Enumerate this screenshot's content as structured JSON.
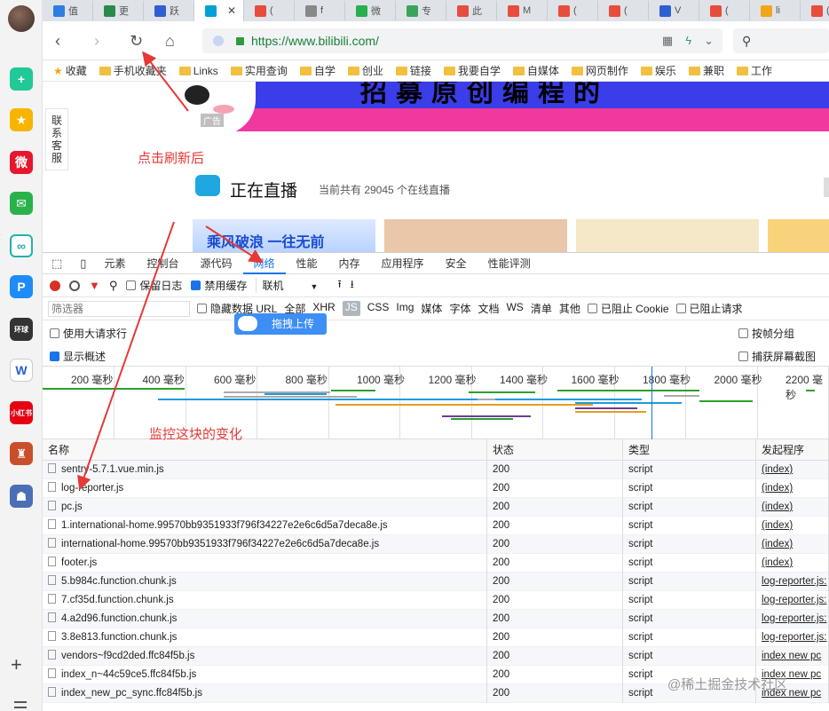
{
  "browser": {
    "tabs": [
      {
        "label": "值",
        "color": "#2f7de1"
      },
      {
        "label": "更",
        "color": "#2a8a4a"
      },
      {
        "label": "跃",
        "color": "#2f5fd1"
      },
      {
        "label": "",
        "color": "#00a1d6",
        "active": true
      },
      {
        "label": "(",
        "color": "#e84c3d"
      },
      {
        "label": "f",
        "color": "#888888"
      },
      {
        "label": "微",
        "color": "#26b04f"
      },
      {
        "label": "专",
        "color": "#3aa55a"
      },
      {
        "label": "此",
        "color": "#e84c3d"
      },
      {
        "label": "M",
        "color": "#e84c3d"
      },
      {
        "label": "(",
        "color": "#e84c3d"
      },
      {
        "label": "(",
        "color": "#e84c3d"
      },
      {
        "label": "V",
        "color": "#2f5fd1"
      },
      {
        "label": "(",
        "color": "#e84c3d"
      },
      {
        "label": "li",
        "color": "#f2a51a"
      },
      {
        "label": "(",
        "color": "#e84c3d"
      }
    ],
    "url": "https://www.bilibili.com/",
    "bookmarks": [
      "收藏",
      "手机收藏夹",
      "Links",
      "实用查询",
      "自学",
      "创业",
      "链接",
      "我要自学",
      "自媒体",
      "网页制作",
      "娱乐",
      "兼职",
      "工作"
    ]
  },
  "page": {
    "contact_lines": [
      "联",
      "系",
      "客",
      "服"
    ],
    "ad_tag": "广告",
    "banner_text": "招募原创编程的",
    "live_title": "正在直播",
    "live_count": "当前共有 29045 个在线直播",
    "thumb_text": "乘风破浪 一往无前"
  },
  "annotations": {
    "refresh": "点击刷新后",
    "monitor": "监控这块的变化"
  },
  "devtools": {
    "tabs": [
      "元素",
      "控制台",
      "源代码",
      "网络",
      "性能",
      "内存",
      "应用程序",
      "安全",
      "性能评测"
    ],
    "toolbar": {
      "preserve_log": "保留日志",
      "disable_cache": "禁用缓存",
      "throttle": "联机"
    },
    "filter": {
      "placeholder": "筛选器",
      "hide_data_url": "隐藏数据 URL",
      "types": [
        "全部",
        "XHR",
        "JS",
        "CSS",
        "Img",
        "媒体",
        "字体",
        "文档",
        "WS",
        "清单",
        "其他"
      ],
      "blocked_cookies": "已阻止 Cookie",
      "blocked_requests": "已阻止请求"
    },
    "options": {
      "large_rows": "使用大请求行",
      "show_overview": "显示概述",
      "group_by_frame": "按帧分组",
      "capture_screenshots": "捕获屏幕截图"
    },
    "timeline_ticks": [
      "200 毫秒",
      "400 毫秒",
      "600 毫秒",
      "800 毫秒",
      "1000 毫秒",
      "1200 毫秒",
      "1400 毫秒",
      "1600 毫秒",
      "1800 毫秒",
      "2000 毫秒",
      "2200 毫秒"
    ],
    "columns": [
      "名称",
      "状态",
      "类型",
      "发起程序"
    ],
    "rows": [
      {
        "name": "sentry-5.7.1.vue.min.js",
        "status": "200",
        "type": "script",
        "initiator": "(index)"
      },
      {
        "name": "log-reporter.js",
        "status": "200",
        "type": "script",
        "initiator": "(index)"
      },
      {
        "name": "pc.js",
        "status": "200",
        "type": "script",
        "initiator": "(index)"
      },
      {
        "name": "1.international-home.99570bb9351933f796f34227e2e6c6d5a7deca8e.js",
        "status": "200",
        "type": "script",
        "initiator": "(index)"
      },
      {
        "name": "international-home.99570bb9351933f796f34227e2e6c6d5a7deca8e.js",
        "status": "200",
        "type": "script",
        "initiator": "(index)"
      },
      {
        "name": "footer.js",
        "status": "200",
        "type": "script",
        "initiator": "(index)"
      },
      {
        "name": "5.b984c.function.chunk.js",
        "status": "200",
        "type": "script",
        "initiator": "log-reporter.js:"
      },
      {
        "name": "7.cf35d.function.chunk.js",
        "status": "200",
        "type": "script",
        "initiator": "log-reporter.js:"
      },
      {
        "name": "4.a2d96.function.chunk.js",
        "status": "200",
        "type": "script",
        "initiator": "log-reporter.js:"
      },
      {
        "name": "3.8e813.function.chunk.js",
        "status": "200",
        "type": "script",
        "initiator": "log-reporter.js:"
      },
      {
        "name": "vendors~f9cd2ded.ffc84f5b.js",
        "status": "200",
        "type": "script",
        "initiator": "index new pc"
      },
      {
        "name": "index_n~44c59ce5.ffc84f5b.js",
        "status": "200",
        "type": "script",
        "initiator": "index new pc"
      },
      {
        "name": "index_new_pc_sync.ffc84f5b.js",
        "status": "200",
        "type": "script",
        "initiator": "index new pc"
      }
    ]
  },
  "overlay": {
    "upload_label": "拖拽上传"
  },
  "watermark": "@稀土掘金技术社区"
}
